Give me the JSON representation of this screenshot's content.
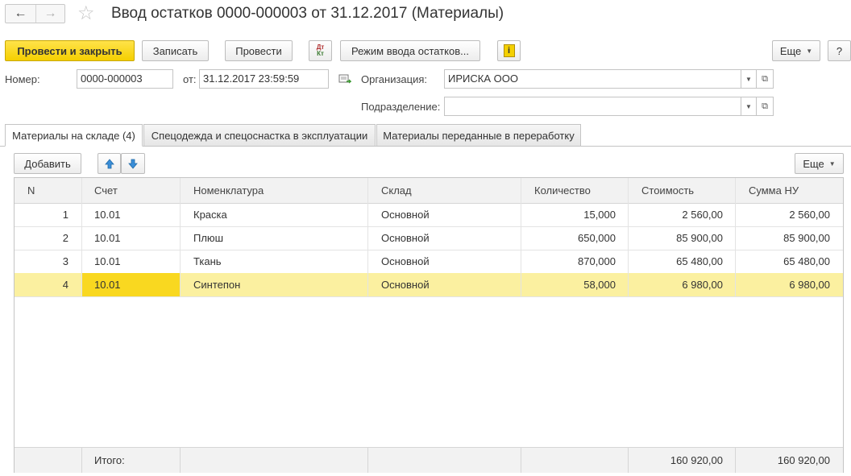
{
  "window": {
    "title": "Ввод остатков 0000-000003 от 31.12.2017 (Материалы)",
    "back_icon": "arrow-left-icon",
    "forward_icon": "arrow-right-icon",
    "favorite_icon": "star-icon"
  },
  "toolbar": {
    "post_close_label": "Провести и закрыть",
    "save_label": "Записать",
    "post_label": "Провести",
    "dt_label": "Дт",
    "kt_label": "Кт",
    "mode_label": "Режим ввода остатков...",
    "info_label": "i",
    "more_label": "Еще",
    "help_label": "?"
  },
  "form": {
    "number_label": "Номер:",
    "number_value": "0000-000003",
    "date_label": "от:",
    "date_value": "31.12.2017 23:59:59",
    "org_label": "Организация:",
    "org_value": "ИРИСКА ООО",
    "dept_label": "Подразделение:",
    "dept_value": ""
  },
  "tabs": [
    {
      "label": "Материалы на складе (4)",
      "active": true
    },
    {
      "label": "Спецодежда и спецоснастка в эксплуатации",
      "active": false
    },
    {
      "label": "Материалы переданные в переработку",
      "active": false
    }
  ],
  "table_toolbar": {
    "add_label": "Добавить",
    "up_icon": "arrow-up-icon",
    "down_icon": "arrow-down-icon",
    "more_label": "Еще"
  },
  "table": {
    "columns": [
      "N",
      "Счет",
      "Номенклатура",
      "Склад",
      "Количество",
      "Стоимость",
      "Сумма НУ"
    ],
    "rows": [
      {
        "n": "1",
        "account": "10.01",
        "item": "Краска",
        "warehouse": "Основной",
        "qty": "15,000",
        "cost": "2 560,00",
        "tax_sum": "2 560,00"
      },
      {
        "n": "2",
        "account": "10.01",
        "item": "Плюш",
        "warehouse": "Основной",
        "qty": "650,000",
        "cost": "85 900,00",
        "tax_sum": "85 900,00"
      },
      {
        "n": "3",
        "account": "10.01",
        "item": "Ткань",
        "warehouse": "Основной",
        "qty": "870,000",
        "cost": "65 480,00",
        "tax_sum": "65 480,00"
      },
      {
        "n": "4",
        "account": "10.01",
        "item": "Синтепон",
        "warehouse": "Основной",
        "qty": "58,000",
        "cost": "6 980,00",
        "tax_sum": "6 980,00"
      }
    ],
    "selected_row": 4,
    "footer": {
      "label": "Итого:",
      "cost": "160 920,00",
      "tax_sum": "160 920,00"
    }
  },
  "colors": {
    "accent": "#f5cf00",
    "selected_row": "#fbf0a0",
    "selected_cell": "#f9d820"
  }
}
